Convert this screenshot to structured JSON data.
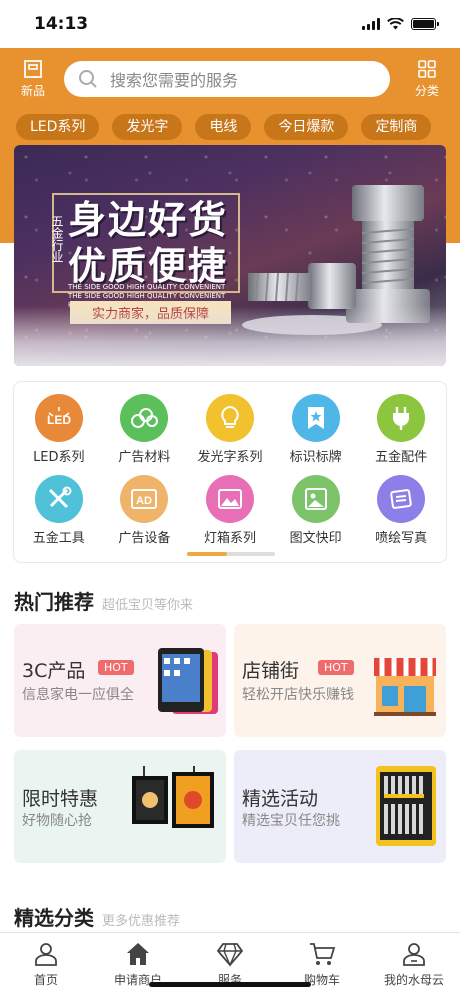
{
  "status_bar": {
    "time": "14:13"
  },
  "header": {
    "new_label": "新品",
    "category_label": "分类",
    "search_placeholder": "搜索您需要的服务"
  },
  "category_pills": [
    "LED系列",
    "发光字",
    "电线",
    "今日爆款",
    "定制商"
  ],
  "banner": {
    "side_text": "五金行业",
    "headline_1": "身边好货",
    "headline_2": "优质便捷",
    "english": "THE SIDE GOOD HIGH QUALITY CONVENIENT THE SIDE GOOD HIGH QUALITY CONVENIENT HIGH QUALITY CONVENIENT",
    "tagline": "实力商家，品质保障"
  },
  "icon_grid": {
    "items": [
      {
        "label": "LED系列",
        "icon": "led-icon",
        "color": "#e8893a"
      },
      {
        "label": "广告材料",
        "icon": "material-rolls-icon",
        "color": "#5bbf5b"
      },
      {
        "label": "发光字系列",
        "icon": "lightbulb-icon",
        "color": "#f2c12e"
      },
      {
        "label": "标识标牌",
        "icon": "badge-star-icon",
        "color": "#4fb6e8"
      },
      {
        "label": "五金配件",
        "icon": "plug-icon",
        "color": "#8cc63f"
      },
      {
        "label": "五金工具",
        "icon": "tools-icon",
        "color": "#4fc1d9"
      },
      {
        "label": "广告设备",
        "icon": "ad-device-icon",
        "color": "#f0b36a"
      },
      {
        "label": "灯箱系列",
        "icon": "lightbox-image-icon",
        "color": "#e86fb6"
      },
      {
        "label": "图文快印",
        "icon": "photo-print-icon",
        "color": "#7cc36a"
      },
      {
        "label": "喷绘写真",
        "icon": "inkjet-print-icon",
        "color": "#8d7fe8"
      }
    ],
    "page_progress": 0.45
  },
  "hot_section": {
    "title": "热门推荐",
    "subtitle": "超低宝贝等你来"
  },
  "promo_cards": [
    {
      "title": "3C产品",
      "subtitle": "信息家电一应俱全",
      "hot": "HOT",
      "bg": "#fbeef2"
    },
    {
      "title": "店铺街",
      "subtitle": "轻松开店快乐赚钱",
      "hot": "HOT",
      "bg": "#fdf3ea"
    },
    {
      "title": "限时特惠",
      "subtitle": "好物随心抢",
      "bg": "#eaf5f1"
    },
    {
      "title": "精选活动",
      "subtitle": "精选宝贝任您挑",
      "bg": "#ecedf8"
    }
  ],
  "category_section": {
    "title": "精选分类",
    "subtitle": "更多优惠推荐"
  },
  "tabbar": [
    {
      "label": "首页",
      "icon": "user-icon"
    },
    {
      "label": "申请商户",
      "icon": "house-icon"
    },
    {
      "label": "服务",
      "icon": "diamond-icon"
    },
    {
      "label": "购物车",
      "icon": "cart-icon"
    },
    {
      "label": "我的水母云",
      "icon": "profile-icon"
    }
  ]
}
